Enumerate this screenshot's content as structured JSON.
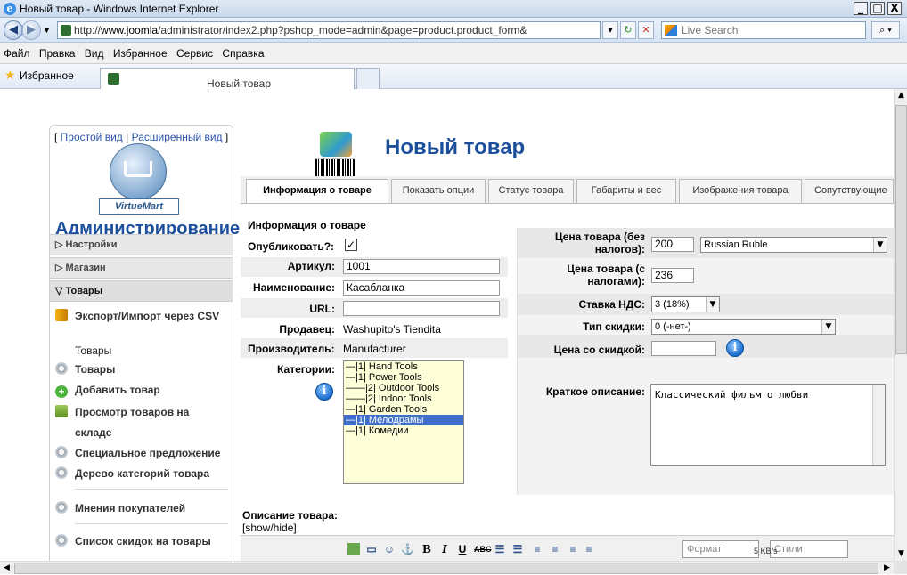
{
  "window": {
    "title": "Новый товар - Windows Internet Explorer",
    "minimize": "_",
    "maximize": "□",
    "close": "X"
  },
  "address": {
    "url_prefix": "http://",
    "url_host": "www.joomla",
    "url_path": "/administrator/index2.php?pshop_mode=admin&page=product.product_form&",
    "search_placeholder": "Live Search"
  },
  "menu": [
    "Файл",
    "Правка",
    "Вид",
    "Избранное",
    "Сервис",
    "Справка"
  ],
  "favorites": {
    "label": "Избранное",
    "tab_title": "Новый товар"
  },
  "sidebar": {
    "view_simple": "Простой вид",
    "view_separator": "|",
    "view_advanced": "Расширенный вид",
    "logo_text": "VirtueMart",
    "admin_title": "Администрирование",
    "sections": [
      {
        "label": "Настройки",
        "marker": "▷"
      },
      {
        "label": "Магазин",
        "marker": "▷"
      },
      {
        "label": "Товары",
        "marker": "▽"
      }
    ],
    "export_link": "Экспорт/Импорт через CSV",
    "products_heading": "Товары",
    "links": [
      {
        "label": "Товары",
        "icon": "gear-icon"
      },
      {
        "label": "Добавить товар",
        "icon": "add-icon"
      },
      {
        "label": "Просмотр товаров на",
        "icon": "stock-icon"
      },
      {
        "label": "складе",
        "icon": ""
      },
      {
        "label": "Специальное предложение",
        "icon": "gear-icon"
      },
      {
        "label": "Дерево категорий товара",
        "icon": "gear-icon"
      },
      {
        "label": "Мнения покупателей",
        "icon": "gear-icon"
      },
      {
        "label": "Список скидок на товары",
        "icon": "gear-icon"
      }
    ]
  },
  "header": {
    "title": "Новый товар"
  },
  "tabs": [
    {
      "label": "Информация о товаре",
      "active": true
    },
    {
      "label": "Показать опции",
      "active": false
    },
    {
      "label": "Статус товара",
      "active": false
    },
    {
      "label": "Габариты и вес",
      "active": false
    },
    {
      "label": "Изображения товара",
      "active": false
    },
    {
      "label": "Сопутствующие",
      "active": false
    }
  ],
  "form": {
    "section_title": "Информация о товаре",
    "publish_label": "Опубликовать?:",
    "publish_checked": "✓",
    "sku_label": "Артикул:",
    "sku_value": "1001",
    "name_label": "Наименование:",
    "name_value": "Касабланка",
    "url_label": "URL:",
    "url_value": "",
    "vendor_label": "Продавец:",
    "vendor_value": "Washupito's Tiendita",
    "manufacturer_label": "Производитель:",
    "manufacturer_value": "Manufacturer",
    "categories_label": "Категории:",
    "categories": [
      {
        "label": "—|1| Hand Tools",
        "selected": false
      },
      {
        "label": "—|1| Power Tools",
        "selected": false
      },
      {
        "label": "——|2| Outdoor Tools",
        "selected": false
      },
      {
        "label": "——|2| Indoor Tools",
        "selected": false
      },
      {
        "label": "—|1| Garden Tools",
        "selected": false
      },
      {
        "label": "—|1| Мелодрамы",
        "selected": true
      },
      {
        "label": "—|1| Комедии",
        "selected": false
      }
    ],
    "price_net_label_1": "Цена товара (без",
    "price_net_label_2": "налогов):",
    "price_net_value": "200",
    "currency_value": "Russian Ruble",
    "price_gross_label_1": "Цена товара (с",
    "price_gross_label_2": "налогами):",
    "price_gross_value": "236",
    "vat_label": "Ставка НДС:",
    "vat_value": "3 (18%)",
    "discount_type_label": "Тип скидки:",
    "discount_type_value": "0 (-нет-)",
    "discounted_price_label": "Цена со скидкой:",
    "discounted_price_value": "",
    "short_desc_label": "Краткое описание:",
    "short_desc_value": "Классический фильм о любви"
  },
  "description": {
    "label": "Описание товара:",
    "toggle": "[show/hide]",
    "format_placeholder": "Формат",
    "styles_placeholder": "Стили",
    "ghost_text": "5 KB/s"
  },
  "colors": {
    "accent": "#1b4f9c",
    "selection": "#3f6fc8",
    "category_bg": "#fefed8"
  }
}
